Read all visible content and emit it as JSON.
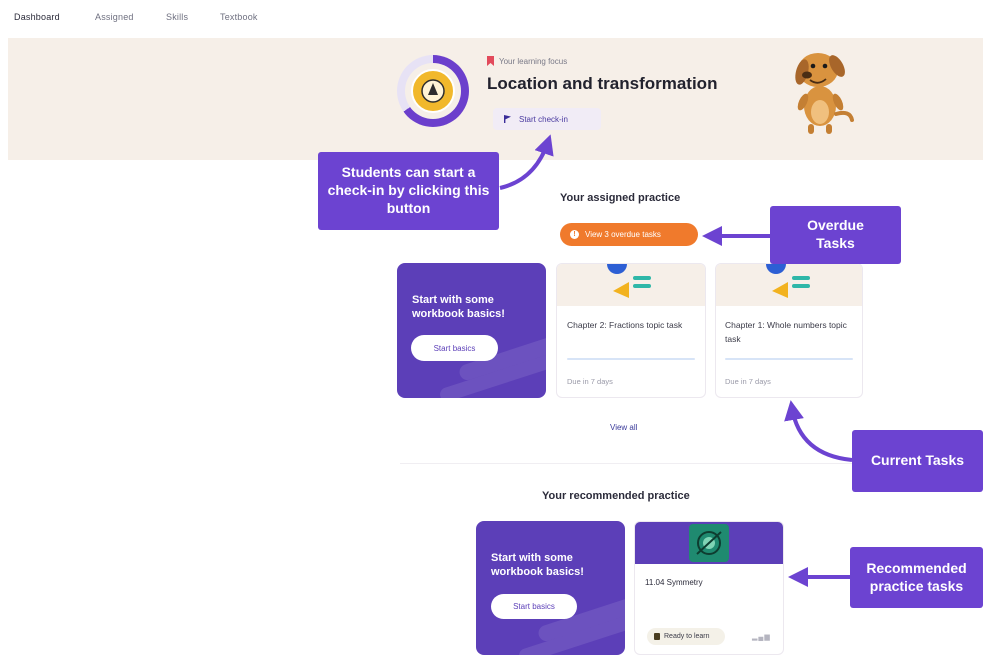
{
  "nav": {
    "items": [
      {
        "label": "Dashboard"
      },
      {
        "label": "Assigned"
      },
      {
        "label": "Skills"
      },
      {
        "label": "Textbook"
      }
    ]
  },
  "focus": {
    "label": "Your learning focus",
    "title": "Location and transformation",
    "checkin_label": "Start check-in"
  },
  "assigned": {
    "title": "Your assigned practice",
    "overdue_label": "View 3 overdue tasks",
    "basics_text": "Start with some workbook basics!",
    "basics_button": "Start basics",
    "tasks": [
      {
        "title": "Chapter 2: Fractions topic task",
        "due": "Due in 7 days"
      },
      {
        "title": "Chapter 1: Whole numbers topic task",
        "due": "Due in 7 days"
      }
    ],
    "view_all": "View all"
  },
  "recommended": {
    "title": "Your recommended practice",
    "basics_text": "Start with some workbook basics!",
    "basics_button": "Start basics",
    "card_title": "11.04 Symmetry",
    "card_status": "Ready to learn"
  },
  "callouts": {
    "checkin": "Students can start a check-in by clicking this button",
    "overdue": "Overdue Tasks",
    "current": "Current Tasks",
    "recommended": "Recommended practice tasks"
  },
  "colors": {
    "purple": "#6c43d1",
    "orange": "#f07a2c",
    "banner": "#f6efe8",
    "gold": "#f1b82b"
  }
}
